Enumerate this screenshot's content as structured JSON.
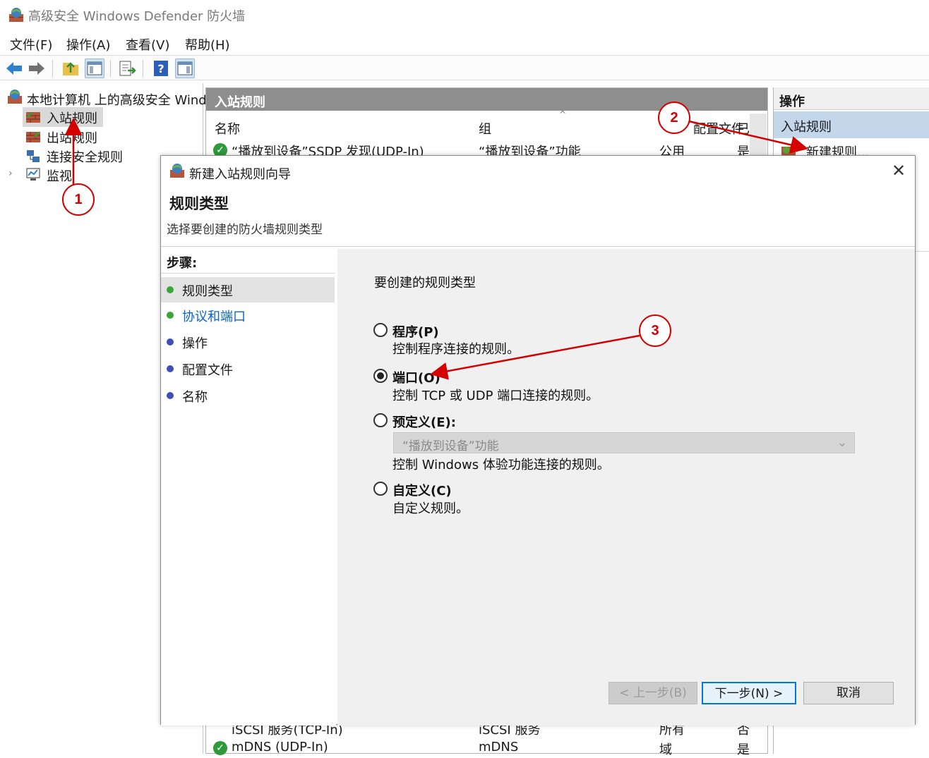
{
  "window": {
    "title": "高级安全 Windows Defender 防火墙"
  },
  "menu": [
    "文件(F)",
    "操作(A)",
    "查看(V)",
    "帮助(H)"
  ],
  "tree": {
    "root": "本地计算机 上的高级安全 Wind",
    "items": [
      "入站规则",
      "出站规则",
      "连接安全规则",
      "监视"
    ]
  },
  "list": {
    "header": "入站规则",
    "columns": [
      "名称",
      "组",
      "配置文件",
      "已"
    ],
    "rows": [
      {
        "name": "“播放到设备”SSDP 发现(UDP-In)",
        "group": "“播放到设备”功能",
        "profile": "公用",
        "enabled": "是"
      },
      {
        "name": "iSCSI 服务(TCP-In)",
        "group": "iSCSI 服务",
        "profile": "所有",
        "enabled": "否"
      },
      {
        "name": "mDNS (UDP-In)",
        "group": "mDNS",
        "profile": "域",
        "enabled": "是"
      }
    ]
  },
  "actions": {
    "header": "操作",
    "section": "入站规则",
    "new_rule": "新建规则..."
  },
  "dialog": {
    "title": "新建入站规则向导",
    "heading": "规则类型",
    "subheading": "选择要创建的防火墙规则类型",
    "steps_label": "步骤:",
    "steps": [
      "规则类型",
      "协议和端口",
      "操作",
      "配置文件",
      "名称"
    ],
    "prompt": "要创建的规则类型",
    "options": [
      {
        "label": "程序(P)",
        "desc": "控制程序连接的规则。",
        "selected": false
      },
      {
        "label": "端口(O)",
        "desc": "控制 TCP 或 UDP 端口连接的规则。",
        "selected": true
      },
      {
        "label": "预定义(E):",
        "desc": "控制 Windows 体验功能连接的规则。",
        "selected": false
      },
      {
        "label": "自定义(C)",
        "desc": "自定义规则。",
        "selected": false
      }
    ],
    "predefined_value": "“播放到设备”功能",
    "buttons": {
      "back": "< 上一步(B)",
      "next": "下一步(N) >",
      "cancel": "取消"
    }
  },
  "annotations": [
    "1",
    "2",
    "3"
  ],
  "colors": {
    "accent": "#0078d7",
    "annotation": "#d40000",
    "selection": "#c3d6ea"
  }
}
